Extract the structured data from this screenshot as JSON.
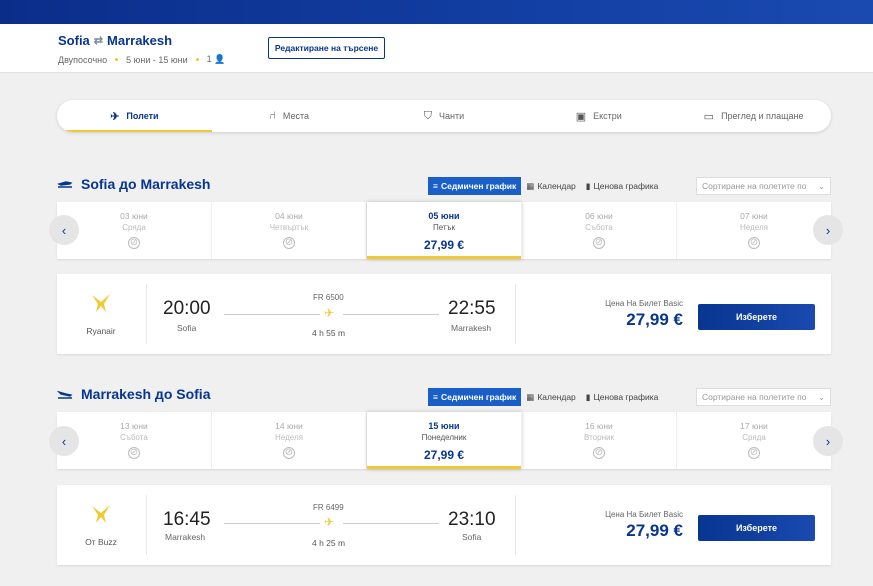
{
  "summary": {
    "origin": "Sofia",
    "destination": "Marrakesh",
    "trip_type": "Двупосочно",
    "dates": "5 юни - 15 юни",
    "passengers": "1",
    "edit_label": "Редактиране на търсене"
  },
  "steps": [
    {
      "label": "Полети",
      "icon": "plane-icon"
    },
    {
      "label": "Места",
      "icon": "seat-icon"
    },
    {
      "label": "Чанти",
      "icon": "bag-icon"
    },
    {
      "label": "Екстри",
      "icon": "bus-icon"
    },
    {
      "label": "Преглед и плащане",
      "icon": "card-icon"
    }
  ],
  "toggles": {
    "weekly": "Седмичен график",
    "calendar": "Календар",
    "price_chart": "Ценова графика",
    "sort_placeholder": "Сортиране на полетите по"
  },
  "outbound": {
    "title": "Sofia до Marrakesh",
    "dates": [
      {
        "d": "03 юни",
        "wd": "Сряда"
      },
      {
        "d": "04 юни",
        "wd": "Четвъртък"
      },
      {
        "d": "05 юни",
        "wd": "Петък",
        "price": "27,99 €"
      },
      {
        "d": "06 юни",
        "wd": "Събота"
      },
      {
        "d": "07 юни",
        "wd": "Неделя"
      }
    ],
    "flight": {
      "airline": "Ryanair",
      "dep_time": "20:00",
      "dep_city": "Sofia",
      "flight_no": "FR 6500",
      "duration": "4 h 55 m",
      "arr_time": "22:55",
      "arr_city": "Marrakesh",
      "fare_label": "Цена На Билет Basic",
      "price": "27,99 €",
      "select_label": "Изберете"
    }
  },
  "inbound": {
    "title": "Marrakesh до Sofia",
    "dates": [
      {
        "d": "13 юни",
        "wd": "Събота"
      },
      {
        "d": "14 юни",
        "wd": "Неделя"
      },
      {
        "d": "15 юни",
        "wd": "Понеделник",
        "price": "27,99 €"
      },
      {
        "d": "16 юни",
        "wd": "Вторник"
      },
      {
        "d": "17 юни",
        "wd": "Сряда"
      }
    ],
    "flight": {
      "airline": "От Buzz",
      "dep_time": "16:45",
      "dep_city": "Marrakesh",
      "flight_no": "FR 6499",
      "duration": "4 h 25 m",
      "arr_time": "23:10",
      "arr_city": "Sofia",
      "fare_label": "Цена На Билет Basic",
      "price": "27,99 €",
      "select_label": "Изберете"
    }
  },
  "colors": {
    "brand_blue": "#073590",
    "accent_yellow": "#f1c933",
    "toggle_active": "#1a5fc7"
  }
}
